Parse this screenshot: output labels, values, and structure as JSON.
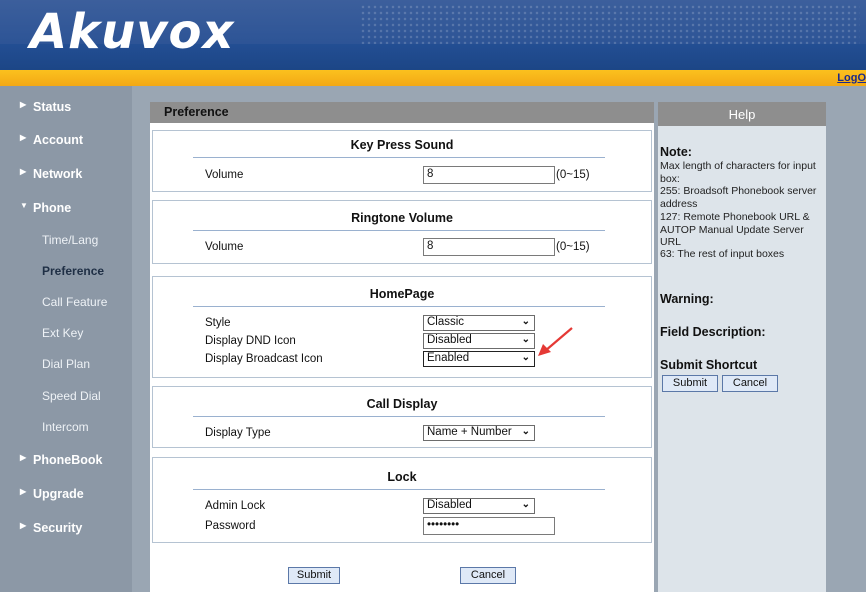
{
  "header": {
    "logo": "Akuvox",
    "logout": "LogO"
  },
  "sidebar": {
    "items": [
      {
        "label": "Status"
      },
      {
        "label": "Account"
      },
      {
        "label": "Network"
      },
      {
        "label": "Phone"
      },
      {
        "label": "PhoneBook"
      },
      {
        "label": "Upgrade"
      },
      {
        "label": "Security"
      }
    ],
    "phone_sub": [
      {
        "label": "Time/Lang"
      },
      {
        "label": "Preference"
      },
      {
        "label": "Call Feature"
      },
      {
        "label": "Ext Key"
      },
      {
        "label": "Dial Plan"
      },
      {
        "label": "Speed Dial"
      },
      {
        "label": "Intercom"
      }
    ],
    "arrow_closed": "▶",
    "arrow_open": "▼"
  },
  "main": {
    "title": "Preference",
    "key_press": {
      "title": "Key Press Sound",
      "volume_label": "Volume",
      "volume_value": "8",
      "range": "(0~15)"
    },
    "ringtone": {
      "title": "Ringtone Volume",
      "volume_label": "Volume",
      "volume_value": "8",
      "range": "(0~15)"
    },
    "homepage": {
      "title": "HomePage",
      "style_label": "Style",
      "style_value": "Classic",
      "dnd_label": "Display DND Icon",
      "dnd_value": "Disabled",
      "broadcast_label": "Display Broadcast Icon",
      "broadcast_value": "Enabled"
    },
    "call_display": {
      "title": "Call Display",
      "type_label": "Display Type",
      "type_value": "Name + Number"
    },
    "lock": {
      "title": "Lock",
      "admin_label": "Admin Lock",
      "admin_value": "Disabled",
      "password_label": "Password",
      "password_value": "••••••••"
    },
    "submit": "Submit",
    "cancel": "Cancel"
  },
  "help": {
    "title": "Help",
    "note_head": "Note:",
    "note_lines": [
      "Max length of characters for input box:",
      "255: Broadsoft Phonebook server address",
      "127: Remote Phonebook URL & AUTOP Manual Update Server URL",
      "63: The rest of input boxes"
    ],
    "warning_head": "Warning:",
    "field_head": "Field Description:",
    "shortcut_head": "Submit Shortcut",
    "submit": "Submit",
    "cancel": "Cancel"
  },
  "colors": {
    "header_blue": "#1d4a8c",
    "accent_orange": "#f3a815",
    "sidebar": "#8c98a6",
    "annotation_arrow": "#e53935"
  },
  "icons": {
    "chevron": "chevron-down-icon",
    "arrow": "annotation-arrow-icon"
  }
}
